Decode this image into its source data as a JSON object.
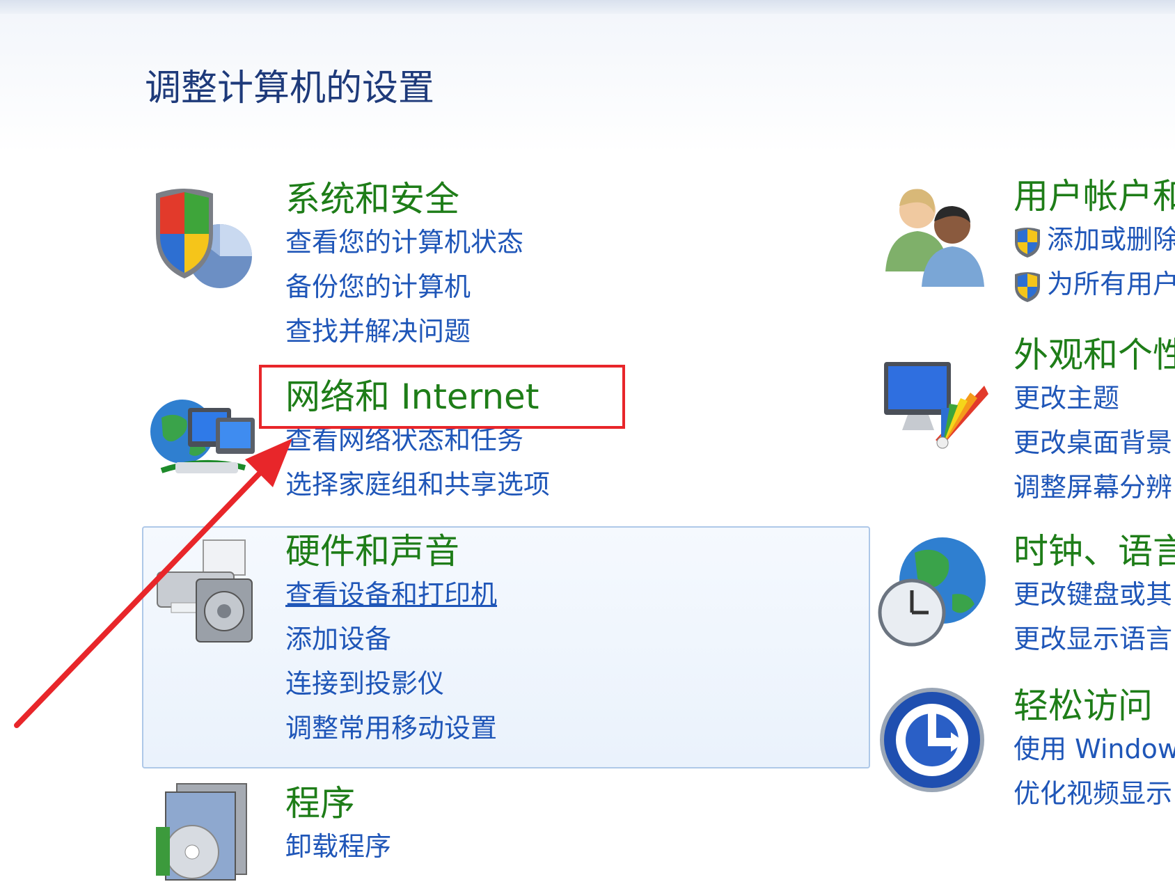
{
  "page_title": "调整计算机的设置",
  "left_column": [
    {
      "title": "系统和安全",
      "icon": "shield-security-icon",
      "links": [
        "查看您的计算机状态",
        "备份您的计算机",
        "查找并解决问题"
      ]
    },
    {
      "title": "网络和 Internet",
      "icon": "network-globe-icon",
      "links": [
        "查看网络状态和任务",
        "选择家庭组和共享选项"
      ]
    },
    {
      "title": "硬件和声音",
      "icon": "printer-speaker-icon",
      "links": [
        "查看设备和打印机",
        "添加设备",
        "连接到投影仪",
        "调整常用移动设置"
      ]
    },
    {
      "title": "程序",
      "icon": "programs-disc-icon",
      "links": [
        "卸载程序"
      ]
    }
  ],
  "right_column": [
    {
      "title": "用户帐户和",
      "icon": "users-icon",
      "links": [
        "添加或删除",
        "为所有用户"
      ]
    },
    {
      "title": "外观和个性",
      "icon": "appearance-monitor-icon",
      "links": [
        "更改主题",
        "更改桌面背景",
        "调整屏幕分辨"
      ]
    },
    {
      "title": "时钟、语言",
      "icon": "clock-globe-icon",
      "links": [
        "更改键盘或其",
        "更改显示语言"
      ]
    },
    {
      "title": "轻松访问",
      "icon": "ease-of-access-icon",
      "links": [
        "使用 Window",
        "优化视频显示"
      ]
    }
  ],
  "colors": {
    "title_blue": "#1e3a7a",
    "category_green": "#1e7d18",
    "link_blue": "#1f56b8",
    "highlight_red": "#e8262a"
  }
}
